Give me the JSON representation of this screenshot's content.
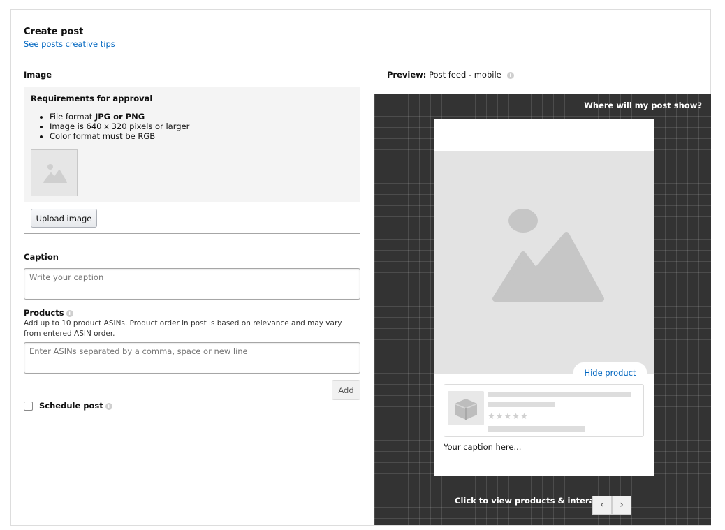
{
  "header": {
    "title": "Create post",
    "tips_link": "See posts creative tips"
  },
  "image_section": {
    "label": "Image",
    "requirements_title": "Requirements for approval",
    "req_1_prefix": "File format ",
    "req_1_bold": "JPG or PNG",
    "req_2": "Image is 640 x 320 pixels or larger",
    "req_3": "Color format must be RGB",
    "upload_label": "Upload image"
  },
  "caption_section": {
    "label": "Caption",
    "placeholder": "Write your caption"
  },
  "products_section": {
    "label": "Products",
    "description": "Add up to 10 product ASINs. Product order in post is based on relevance and may vary from entered ASIN order.",
    "placeholder": "Enter ASINs separated by a comma, space or new line",
    "add_label": "Add"
  },
  "schedule": {
    "label": "Schedule post",
    "checked": false
  },
  "preview": {
    "heading_bold": "Preview:",
    "heading_value": "Post feed - mobile",
    "where_link": "Where will my post show?",
    "hide_product": "Hide product",
    "caption_placeholder": "Your caption here...",
    "stars": "★★★★★",
    "nav_text": "Click to view products & interaction",
    "prev_glyph": "‹",
    "next_glyph": "›"
  },
  "colors": {
    "link": "#0066c0",
    "preview_background": "#333333"
  }
}
